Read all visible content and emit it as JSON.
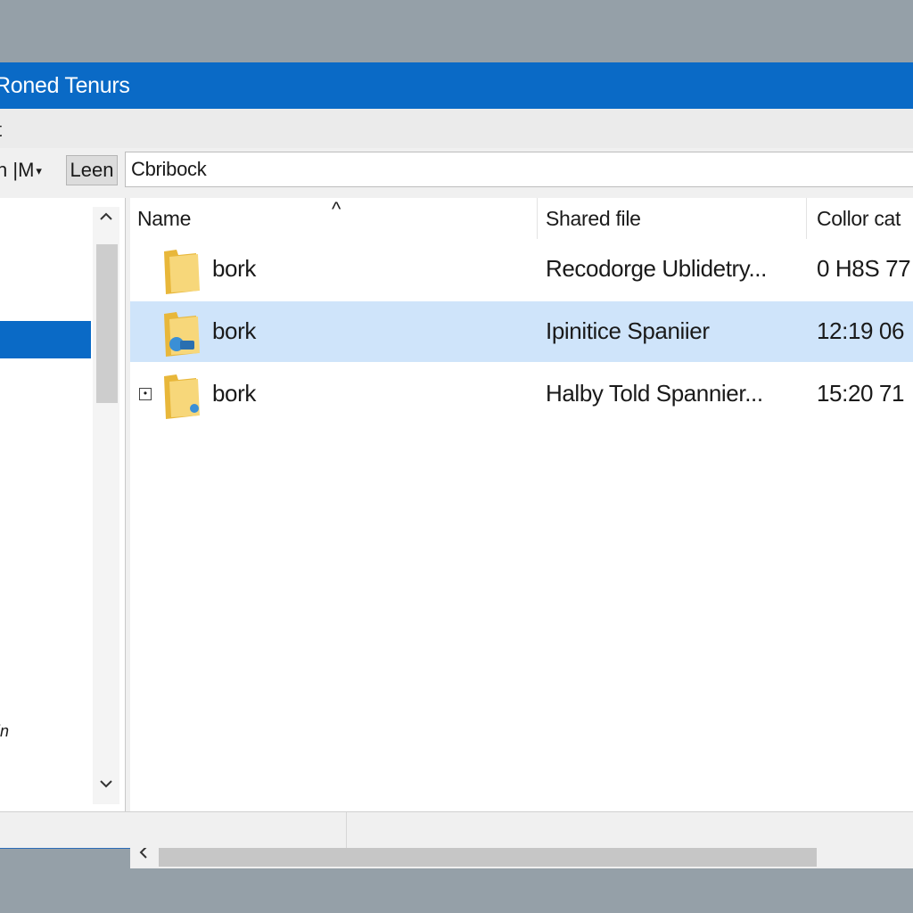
{
  "window": {
    "title": "Roned Tenurs"
  },
  "menubar": {
    "items": [
      "t"
    ]
  },
  "toolbar": {
    "view_label": "h |M",
    "view_caret": "▾",
    "lens_label": "Leen",
    "address_value": "Cbribock"
  },
  "nav": {
    "bottom_label": "in"
  },
  "columns": [
    "Name",
    "Shared file",
    "Collor cat"
  ],
  "sort_indicator": "^",
  "rows": [
    {
      "name": "bork",
      "shared": "Recodorge Ublidetry...",
      "color": "0 H8S 77",
      "selected": false
    },
    {
      "name": "bork",
      "shared": "Ipinitice Spaniier",
      "color": "12:19 06",
      "selected": true
    },
    {
      "name": "bork",
      "shared": "Halby Told Spannier...",
      "color": "15:20 71",
      "selected": false
    }
  ],
  "icons": {
    "folder": "folder-icon",
    "shared_folder": "shared-folder-icon",
    "scroll_up": "chevron-up-icon",
    "scroll_down": "chevron-down-icon",
    "scroll_left": "chevron-left-icon",
    "expander": "expand-icon"
  },
  "colors": {
    "titlebar": "#0a6ac6",
    "selection": "#cfe4fa",
    "nav_selection": "#0a6ac6",
    "folder": "#f2c94c"
  }
}
